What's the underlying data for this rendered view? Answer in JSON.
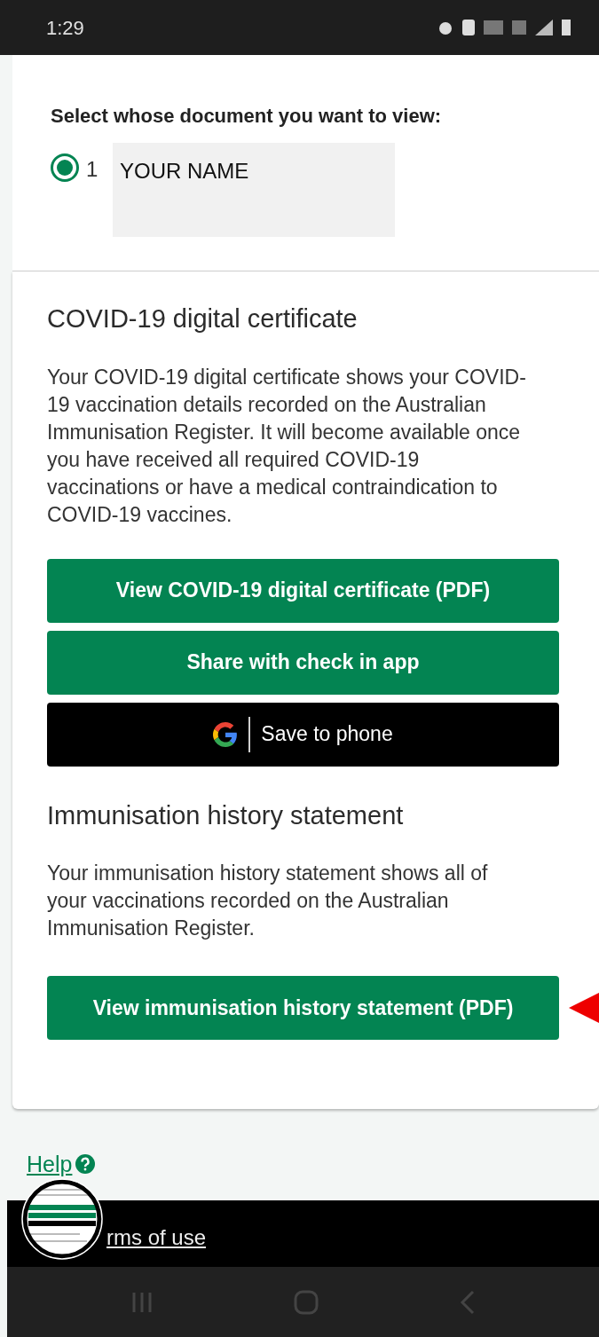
{
  "status_bar": {
    "time": "1:29"
  },
  "selector": {
    "prompt": "Select whose document you want to view:",
    "options": [
      {
        "number": "1",
        "name": "YOUR NAME",
        "selected": true
      }
    ]
  },
  "sections": [
    {
      "title": "COVID-19 digital certificate",
      "body": "Your COVID-19 digital certificate shows your COVID-19 vaccination details recorded on the Australian Immunisation Register. It will become available once you have received all required COVID-19 vaccinations or have a medical contraindication to COVID-19 vaccines.",
      "buttons": [
        {
          "kind": "primary",
          "label": "View COVID-19 digital certificate (PDF)"
        },
        {
          "kind": "primary",
          "label": "Share with check in app"
        },
        {
          "kind": "google",
          "label": "Save to phone"
        }
      ]
    },
    {
      "title": "Immunisation history statement",
      "body": "Your immunisation history statement shows all of your vaccinations recorded on the Australian Immunisation Register.",
      "buttons": [
        {
          "kind": "primary",
          "label": "View immunisation history statement (PDF)",
          "pointed": true
        }
      ]
    }
  ],
  "help_link": "Help",
  "footer_links": [
    "rms of use"
  ]
}
